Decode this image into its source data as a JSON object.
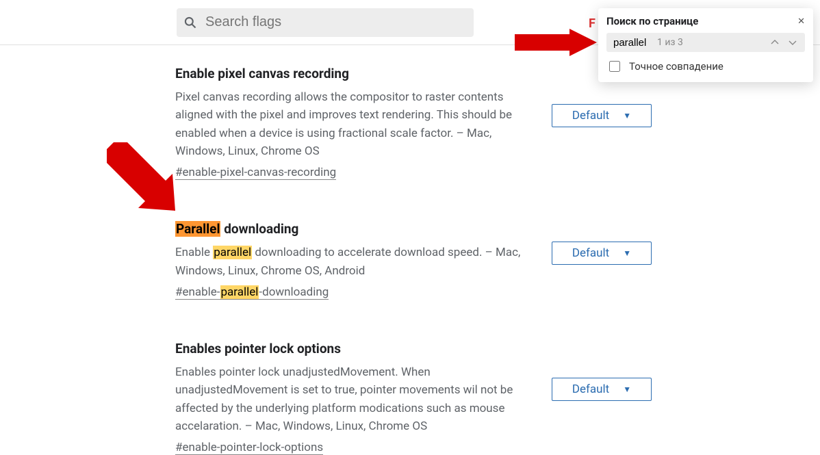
{
  "search": {
    "placeholder": "Search flags",
    "value": ""
  },
  "flags": [
    {
      "title": "Enable pixel canvas recording",
      "desc": "Pixel canvas recording allows the compositor to raster contents aligned with the pixel and improves text rendering. This should be enabled when a device is using fractional scale factor. – Mac, Windows, Linux, Chrome OS",
      "anchor": "#enable-pixel-canvas-recording",
      "select": "Default"
    },
    {
      "title_pre": "",
      "title_hl": "Parallel",
      "title_post": " downloading",
      "desc_pre": "Enable ",
      "desc_hl": "parallel",
      "desc_post": " downloading to accelerate download speed. – Mac, Windows, Linux, Chrome OS, Android",
      "anchor_pre": "#enable-",
      "anchor_hl": "parallel",
      "anchor_post": "-downloading",
      "select": "Default"
    },
    {
      "title": "Enables pointer lock options",
      "desc": "Enables pointer lock unadjustedMovement. When unadjustedMovement is set to true, pointer movements wil not be affected by the underlying platform modications such as mouse accelaration. – Mac, Windows, Linux, Chrome OS",
      "anchor": "#enable-pointer-lock-options",
      "select": "Default"
    }
  ],
  "find": {
    "title": "Поиск по странице",
    "value": "parallel",
    "count": "1 из 3",
    "exact_label": "Точное совпадение"
  },
  "partial_letter": "F"
}
